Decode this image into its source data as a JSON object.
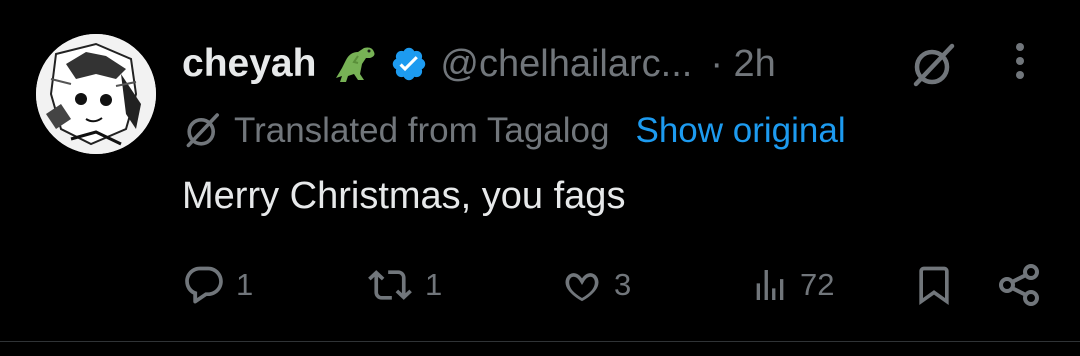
{
  "user": {
    "display_name": "cheyah",
    "emoji": "dinosaur-emoji",
    "verified": true,
    "handle": "@chelhailarc...",
    "time": "· 2h"
  },
  "translation": {
    "label": "Translated from Tagalog",
    "show_original": "Show original"
  },
  "tweet": {
    "text": "Merry Christmas, you fags"
  },
  "actions": {
    "replies": "1",
    "reposts": "1",
    "likes": "3",
    "views": "72"
  },
  "colors": {
    "background": "#000000",
    "text_primary": "#e7e9ea",
    "text_secondary": "#71767b",
    "accent": "#1d9bf0"
  }
}
